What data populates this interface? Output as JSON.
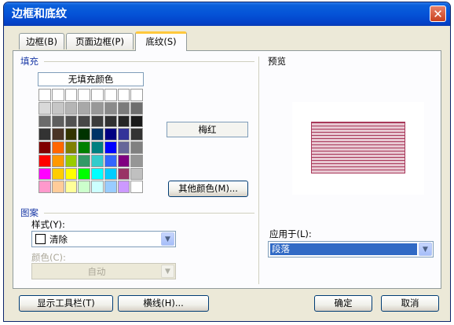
{
  "window": {
    "title": "边框和底纹",
    "close_symbol": "✕"
  },
  "tabs": [
    {
      "label": "边框(B)"
    },
    {
      "label": "页面边框(P)"
    },
    {
      "label": "底纹(S)"
    }
  ],
  "fill": {
    "group_label": "填充",
    "no_fill_label": "无填充颜色",
    "selected_color_name": "梅红",
    "more_colors_label": "其他颜色(M)...",
    "palette": [
      [
        "#FFFFFF",
        "#FFFFFF",
        "#FFFFFF",
        "#FFFFFF",
        "#FFFFFF",
        "#FFFFFF",
        "#FFFFFF",
        "#FFFFFF"
      ],
      [
        "#D9D9D9",
        "#C6C6C6",
        "#B5B5B5",
        "#A8A8A8",
        "#989898",
        "#8A8A8A",
        "#7B7B7B",
        "#6E6E6E"
      ],
      [
        "#6B6B6B",
        "#5E5E5E",
        "#525252",
        "#474747",
        "#3C3C3C",
        "#313131",
        "#262626",
        "#1A1A1A"
      ],
      [
        "#333333",
        "#4A3426",
        "#333300",
        "#003300",
        "#003366",
        "#000080",
        "#333399",
        "#333333"
      ],
      [
        "#800000",
        "#FF6600",
        "#808000",
        "#008000",
        "#008080",
        "#0000FF",
        "#666699",
        "#808080"
      ],
      [
        "#FF0000",
        "#FF9900",
        "#99CC00",
        "#339966",
        "#33CCCC",
        "#3366FF",
        "#800080",
        "#969696"
      ],
      [
        "#FF00FF",
        "#FFCC00",
        "#FFFF00",
        "#00FF00",
        "#00FFFF",
        "#00CCFF",
        "#993366",
        "#C0C0C0"
      ],
      [
        "#FF99CC",
        "#FFCC99",
        "#FFFF99",
        "#CCFFCC",
        "#CCFFFF",
        "#99CCFF",
        "#CC99FF",
        "#FFFFFF"
      ]
    ]
  },
  "pattern": {
    "group_label": "图案",
    "style_label": "样式(Y):",
    "style_value": "清除",
    "color_label": "颜色(C):",
    "color_value": "自动"
  },
  "preview": {
    "group_label": "预览",
    "apply_to_label": "应用于(L):",
    "apply_to_value": "段落",
    "shade_color": "#A8385A"
  },
  "footer": {
    "show_toolbar_label": "显示工具栏(T)",
    "horizontal_line_label": "横线(H)...",
    "ok_label": "确定",
    "cancel_label": "取消"
  },
  "icons": {
    "dropdown": "chevron-down-icon",
    "close": "close-icon"
  }
}
